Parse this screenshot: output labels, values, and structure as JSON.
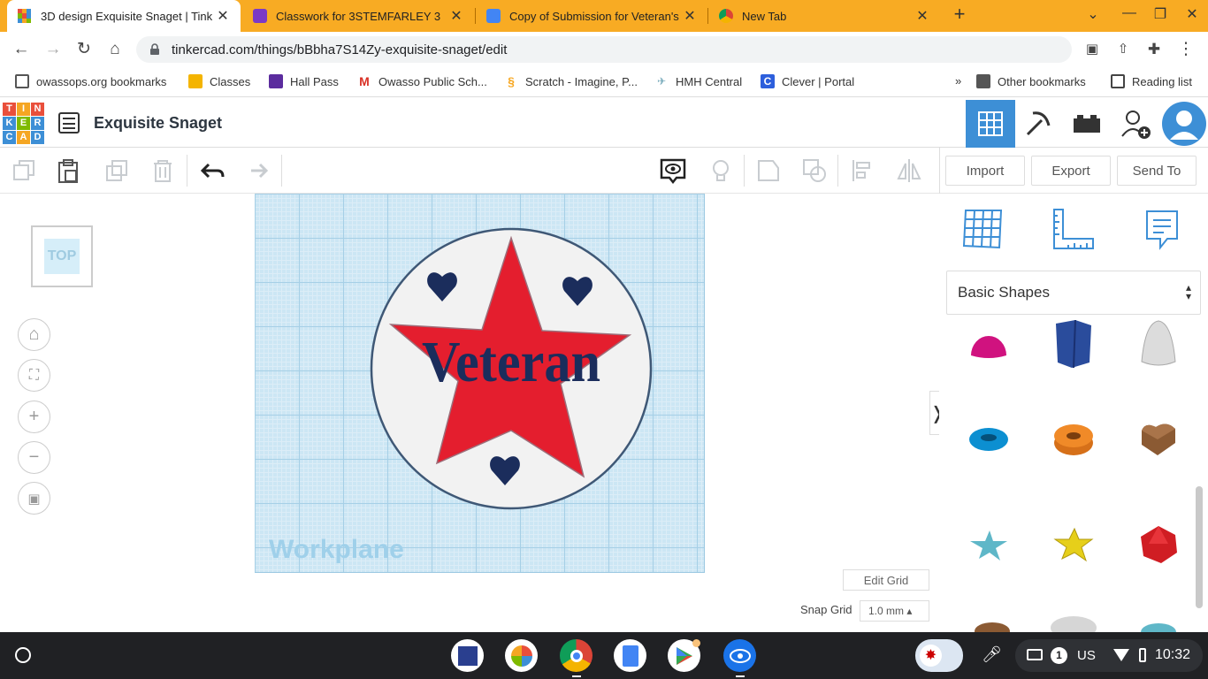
{
  "browser": {
    "tabs": [
      {
        "title": "3D design Exquisite Snaget | Tink",
        "favicon": "tinkercad-icon",
        "active": true
      },
      {
        "title": "Classwork for 3STEMFARLEY 3",
        "favicon": "classroom-icon",
        "active": false
      },
      {
        "title": "Copy of Submission for Veteran's",
        "favicon": "docs-icon",
        "active": false
      },
      {
        "title": "New Tab",
        "favicon": "chrome-icon",
        "active": false
      }
    ],
    "url": "tinkercad.com/things/bBbha7S14Zy-exquisite-snaget/edit",
    "bookmarks": [
      {
        "label": "owassops.org bookmarks",
        "icon": "folder-icon"
      },
      {
        "label": "Classes",
        "icon": "classroom-icon"
      },
      {
        "label": "Hall Pass",
        "icon": "list-icon"
      },
      {
        "label": "Owasso Public Sch...",
        "icon": "gmail-icon"
      },
      {
        "label": "Scratch - Imagine, P...",
        "icon": "scratch-icon"
      },
      {
        "label": "HMH Central",
        "icon": "hmh-icon"
      },
      {
        "label": "Clever | Portal",
        "icon": "clever-icon"
      }
    ],
    "other_bookmarks": "Other bookmarks",
    "reading_list": "Reading list",
    "overflow": "»"
  },
  "tinkercad": {
    "logo_letters": [
      "T",
      "I",
      "N",
      "K",
      "E",
      "R",
      "C",
      "A",
      "D"
    ],
    "design_title": "Exquisite Snaget",
    "buttons": {
      "import": "Import",
      "export": "Export",
      "send_to": "Send To"
    },
    "viewcube_label": "TOP",
    "workplane_label": "Workplane",
    "design_text": "Veteran",
    "edit_grid": "Edit Grid",
    "snap_grid_label": "Snap Grid",
    "snap_grid_value": "1.0 mm ▴",
    "shape_category": "Basic Shapes",
    "colors": {
      "accent": "#3d8fd6",
      "star": "#e41e2e",
      "navy": "#1b2d5c"
    }
  },
  "shelf": {
    "keyboard": "US",
    "notifications": "1",
    "time": "10:32"
  }
}
